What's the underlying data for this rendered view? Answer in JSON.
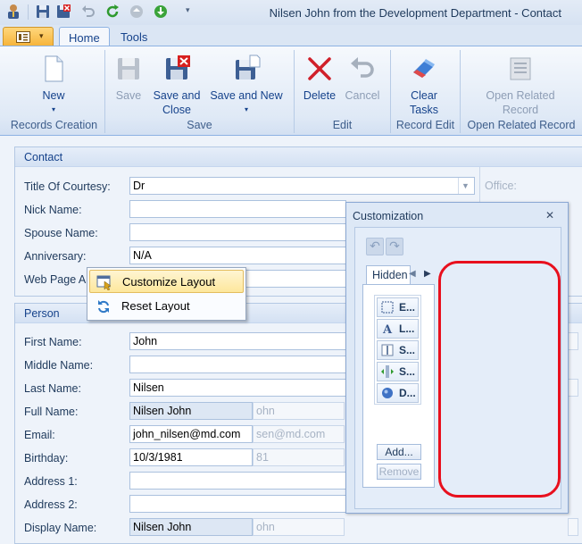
{
  "window": {
    "title": "Nilsen John from the Development Department - Contact"
  },
  "ribbon": {
    "tabs": [
      "Home",
      "Tools"
    ],
    "buttons": {
      "new": "New",
      "save": "Save",
      "save_and_close_1": "Save and",
      "save_and_close_2": "Close",
      "save_and_new": "Save and New",
      "delete": "Delete",
      "cancel": "Cancel",
      "clear_tasks_1": "Clear",
      "clear_tasks_2": "Tasks",
      "open_related_1": "Open Related",
      "open_related_2": "Record"
    },
    "groups": {
      "records_creation": "Records Creation",
      "save": "Save",
      "edit": "Edit",
      "record_edit": "Record Edit",
      "open_related_record": "Open Related Record"
    }
  },
  "contact_group": {
    "header": "Contact",
    "office_label": "Office:",
    "fields": [
      {
        "label": "Title Of Courtesy:",
        "value": "Dr"
      },
      {
        "label": "Nick Name:",
        "value": ""
      },
      {
        "label": "Spouse Name:",
        "value": ""
      },
      {
        "label": "Anniversary:",
        "value": "N/A"
      },
      {
        "label": "Web Page A",
        "value": ""
      }
    ]
  },
  "person_group": {
    "header": "Person",
    "fields": [
      {
        "label": "First Name:",
        "value": "John"
      },
      {
        "label": "Middle Name:",
        "value": ""
      },
      {
        "label": "Last Name:",
        "value": "Nilsen"
      },
      {
        "label": "Full Name:",
        "value": "Nilsen John",
        "ghost": "ohn"
      },
      {
        "label": "Email:",
        "value": "john_nilsen@md.com",
        "ghost": "sen@md.com"
      },
      {
        "label": "Birthday:",
        "value": "10/3/1981",
        "ghost": "81"
      },
      {
        "label": "Address 1:",
        "value": ""
      },
      {
        "label": "Address 2:",
        "value": ""
      },
      {
        "label": "Display Name:",
        "value": "Nilsen John",
        "ghost": "ohn"
      }
    ]
  },
  "context_menu": {
    "items": [
      "Customize Layout",
      "Reset Layout"
    ]
  },
  "customization": {
    "title": "Customization",
    "close_glyph": "✕",
    "hidden_tab": "Hidden",
    "hidden_items": [
      "E...",
      "L...",
      "S...",
      "S...",
      "D..."
    ],
    "add_button": "Add...",
    "remove_button": "Remove"
  }
}
